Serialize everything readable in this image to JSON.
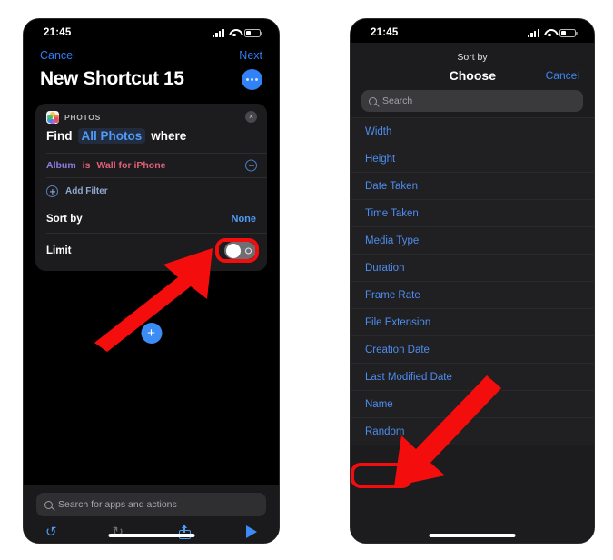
{
  "left_phone": {
    "status": {
      "time": "21:45",
      "signal_icon": "cellular-bars-icon",
      "wifi_icon": "wifi-icon",
      "battery_icon": "battery-icon"
    },
    "nav": {
      "cancel": "Cancel",
      "next": "Next"
    },
    "title": "New Shortcut 15",
    "more_button": "more-options",
    "action_card": {
      "app_name": "PHOTOS",
      "close": "×",
      "sentence": {
        "find": "Find",
        "token": "All Photos",
        "where": "where"
      },
      "filter": {
        "field": "Album",
        "operator": "is",
        "value": "Wall for iPhone"
      },
      "add_filter": "Add Filter",
      "sort_by": {
        "label": "Sort by",
        "value": "None"
      },
      "limit": {
        "label": "Limit",
        "toggle_state": "off"
      }
    },
    "fab": "+",
    "dock": {
      "search_placeholder": "Search for apps and actions",
      "undo": "undo-icon",
      "redo": "redo-icon",
      "share": "share-icon",
      "run": "play-icon"
    }
  },
  "right_phone": {
    "status": {
      "time": "21:45",
      "signal_icon": "cellular-bars-icon",
      "wifi_icon": "wifi-icon",
      "battery_icon": "battery-icon"
    },
    "sheet": {
      "title": "Sort by",
      "heading": "Choose",
      "cancel": "Cancel",
      "search_placeholder": "Search",
      "options": [
        "Width",
        "Height",
        "Date Taken",
        "Time Taken",
        "Media Type",
        "Duration",
        "Frame Rate",
        "File Extension",
        "Creation Date",
        "Last Modified Date",
        "Name",
        "Random"
      ]
    }
  },
  "annotations": {
    "highlight_color": "#f40d0d",
    "arrow_color": "#f40d0d",
    "highlight_left_target": "None",
    "highlight_right_target": "Random",
    "arrow_left": "points-up-right-to-none-value",
    "arrow_right": "points-down-left-to-random-option"
  },
  "colors": {
    "accent_blue": "#4e9bf7",
    "sheet_blue": "#4e8cf0",
    "field_purple": "#8b7ce0",
    "field_pink": "#e0607a",
    "card_bg": "#1c1c1e",
    "screen_bg": "#000000"
  }
}
